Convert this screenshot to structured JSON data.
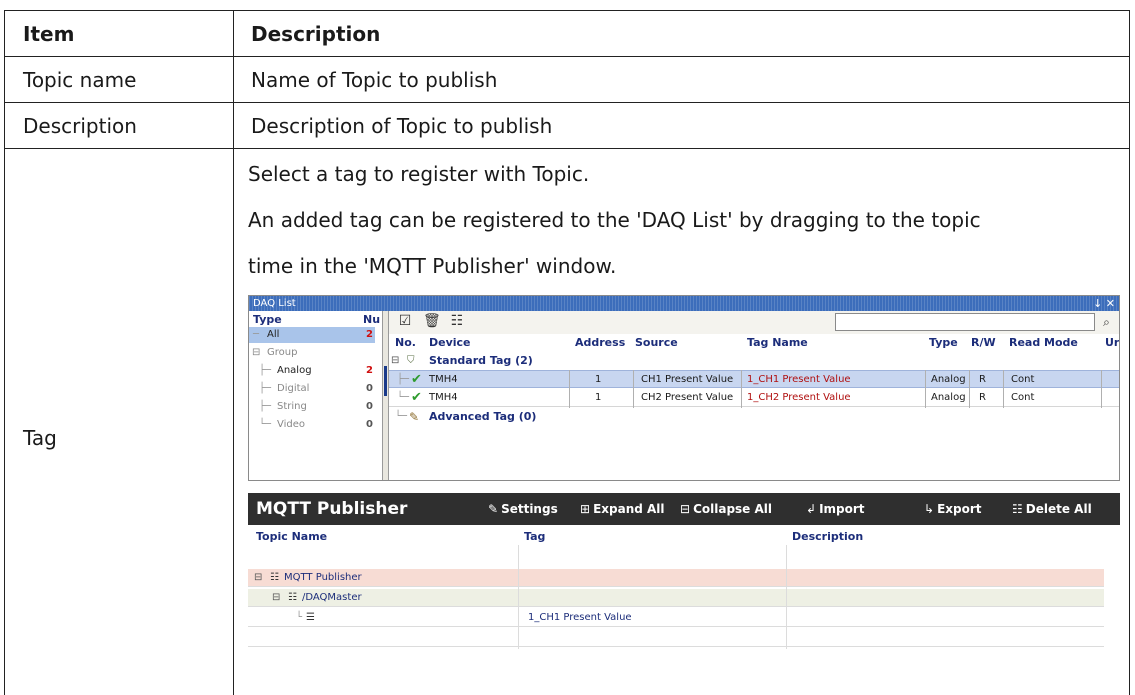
{
  "table": {
    "header": {
      "item": "Item",
      "description": "Description"
    },
    "rows": [
      {
        "item": "Topic name",
        "description": "Name of Topic to publish"
      },
      {
        "item": "Description",
        "description": "Description of Topic to publish"
      },
      {
        "item": "Tag",
        "lines": [
          "Select a tag to register with Topic.",
          "An added tag can be registered to the 'DAQ List' by dragging to the topic",
          "time in the 'MQTT Publisher' window."
        ]
      }
    ]
  },
  "daq_list": {
    "title": "DAQ List",
    "title_controls": "p ×",
    "tree_header": {
      "type": "Type",
      "num": "Nu"
    },
    "tree": [
      {
        "label": "All",
        "count": "2"
      },
      {
        "label": "Group",
        "count": ""
      },
      {
        "label": "Analog",
        "count": "2"
      },
      {
        "label": "Digital",
        "count": "0"
      },
      {
        "label": "String",
        "count": "0"
      },
      {
        "label": "Video",
        "count": "0"
      }
    ],
    "columns": [
      "No.",
      "Device",
      "Address",
      "Source",
      "Tag Name",
      "Type",
      "R/W",
      "Read Mode",
      "Ur"
    ],
    "group_standard": "Standard Tag (2)",
    "group_advanced": "Advanced Tag (0)",
    "rows": [
      {
        "device": "TMH4",
        "address": "1",
        "source": "CH1 Present Value",
        "tag_name": "1_CH1 Present Value",
        "type": "Analog",
        "rw": "R",
        "read_mode": "Cont"
      },
      {
        "device": "TMH4",
        "address": "1",
        "source": "CH2 Present Value",
        "tag_name": "1_CH2 Present Value",
        "type": "Analog",
        "rw": "R",
        "read_mode": "Cont"
      }
    ]
  },
  "mqtt": {
    "title": "MQTT Publisher",
    "buttons": {
      "settings": "Settings",
      "expand": "Expand All",
      "collapse": "Collapse All",
      "import": "Import",
      "export": "Export",
      "delete": "Delete All"
    },
    "columns": {
      "topic": "Topic Name",
      "tag": "Tag",
      "description": "Description"
    },
    "rows": [
      {
        "topic": "MQTT Publisher",
        "tag": "",
        "description": ""
      },
      {
        "topic": "/DAQMaster",
        "tag": "",
        "description": ""
      },
      {
        "topic": "",
        "tag": "1_CH1 Present Value",
        "description": ""
      }
    ]
  },
  "colors": {
    "selected_row": "#c8d6f0",
    "tag_name_red": "#b01010",
    "header_blue": "#1c2d7a",
    "mqtt_root_bg": "#f7dcd4",
    "mqtt_child_bg": "#eef0e4"
  }
}
